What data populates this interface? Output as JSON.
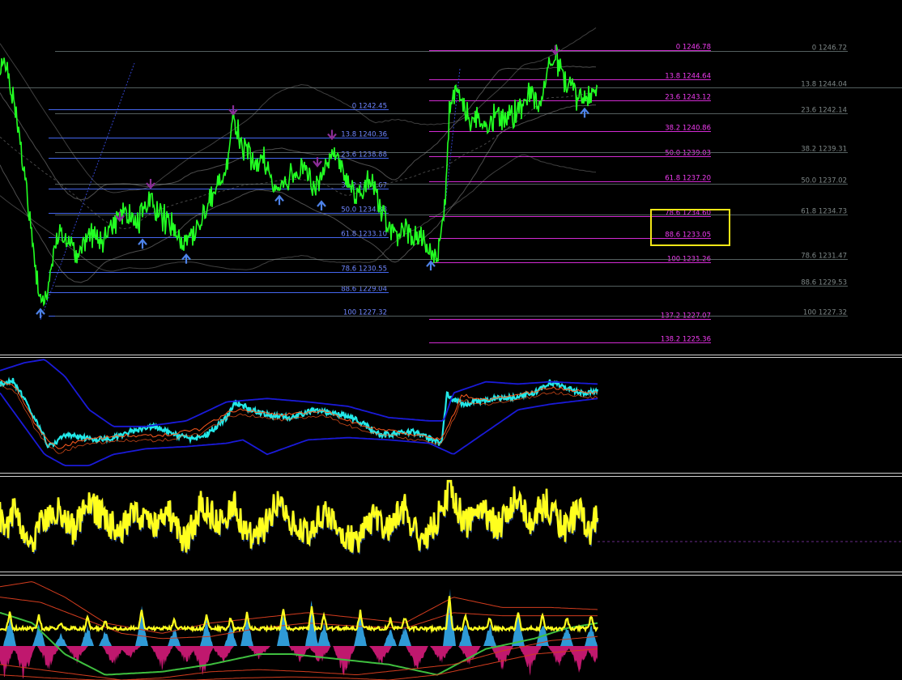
{
  "colors": {
    "background": "#000000",
    "price": "#22ff22",
    "fib_left": "#4466ee",
    "fib_left_text": "#6f86ff",
    "fib_mid": "#d22ad2",
    "fib_mid_text": "#f03cf0",
    "fib_right": "#5e6a6a",
    "fib_right_text": "#7e8787",
    "envelope": "#8c8c8c",
    "highlight_box": "#f3e617",
    "arrow_up": "#4d82e8",
    "arrow_down": "#8b2d96",
    "osc_fast": "#22e8e8",
    "osc_band": "#1a1ad8",
    "osc_slow": "#ff5a1e",
    "rsi": "#ffff1e",
    "rsi_shadow": "#3a6fd8",
    "hist_pos": "#2f9ad6",
    "hist_neg": "#c0186e",
    "ma_green": "#3fbf3f",
    "ma_red": "#d23c1e",
    "separator": "#cfcfcf"
  },
  "chart_data": [
    {
      "type": "line",
      "panel": "price",
      "x_range": [
        0,
        738
      ],
      "ylim": [
        1224.6,
        1250.0
      ],
      "series": [
        {
          "role": "close",
          "anchors_x": [
            0,
            10,
            20,
            30,
            38,
            48,
            55,
            62,
            70,
            82,
            95,
            110,
            125,
            140,
            155,
            170,
            185,
            200,
            212,
            225,
            235,
            250,
            265,
            278,
            288,
            300,
            312,
            325,
            335,
            345,
            360,
            375,
            390,
            400,
            410,
            420,
            432,
            445,
            458,
            470,
            480,
            490,
            505,
            520,
            530,
            538,
            545,
            550,
            555,
            562,
            572,
            580,
            590,
            600,
            612,
            625,
            640,
            655,
            668,
            678,
            686,
            693,
            700,
            710,
            722,
            730,
            738
          ],
          "anchors_y": [
            1246.0,
            1244.8,
            1242.0,
            1238.0,
            1234.0,
            1229.0,
            1228.6,
            1230.0,
            1233.5,
            1233.0,
            1232.0,
            1233.5,
            1232.5,
            1234.0,
            1235.0,
            1234.2,
            1236.0,
            1234.5,
            1234.0,
            1232.5,
            1233.0,
            1235.0,
            1236.5,
            1238.0,
            1241.5,
            1239.8,
            1238.5,
            1238.8,
            1237.5,
            1236.8,
            1237.5,
            1238.2,
            1236.5,
            1238.0,
            1239.5,
            1238.5,
            1237.0,
            1236.0,
            1237.2,
            1235.2,
            1233.5,
            1233.3,
            1233.5,
            1233.0,
            1232.0,
            1231.3,
            1233.0,
            1236.0,
            1242.0,
            1244.0,
            1243.0,
            1241.5,
            1242.0,
            1241.0,
            1242.0,
            1241.5,
            1242.5,
            1243.5,
            1242.5,
            1246.0,
            1246.3,
            1245.3,
            1244.0,
            1243.5,
            1243.0,
            1243.8,
            1244.0
          ]
        }
      ],
      "fibonacci_sets": [
        {
          "role": "left",
          "levels": [
            {
              "ratio": "0",
              "price": 1242.45,
              "label": "0 1242.45"
            },
            {
              "ratio": "13.8",
              "price": 1240.36,
              "label": "13.8 1240.36"
            },
            {
              "ratio": "23.6",
              "price": 1238.88,
              "label": "23.6 1238.88"
            },
            {
              "ratio": "38.2",
              "price": 1236.67,
              "label": "38.2 1236.67"
            },
            {
              "ratio": "50.0",
              "price": 1234.88,
              "label": "50.0 1234.88"
            },
            {
              "ratio": "61.8",
              "price": 1233.1,
              "label": "61.8 1233.10"
            },
            {
              "ratio": "78.6",
              "price": 1230.55,
              "label": "78.6 1230.55"
            },
            {
              "ratio": "88.6",
              "price": 1229.04,
              "label": "88.6 1229.04"
            },
            {
              "ratio": "100",
              "price": 1227.32,
              "label": "100 1227.32"
            }
          ]
        },
        {
          "role": "middle",
          "levels": [
            {
              "ratio": "0",
              "price": 1246.78,
              "label": "0 1246.78"
            },
            {
              "ratio": "13.8",
              "price": 1244.64,
              "label": "13.8 1244.64"
            },
            {
              "ratio": "23.6",
              "price": 1243.12,
              "label": "23.6 1243.12"
            },
            {
              "ratio": "38.2",
              "price": 1240.86,
              "label": "38.2 1240.86"
            },
            {
              "ratio": "50.0",
              "price": 1239.03,
              "label": "50.0 1239.03"
            },
            {
              "ratio": "61.8",
              "price": 1237.2,
              "label": "61.8 1237.20"
            },
            {
              "ratio": "78.6",
              "price": 1234.6,
              "label": "78.6 1234.60"
            },
            {
              "ratio": "88.6",
              "price": 1233.05,
              "label": "88.6 1233.05"
            },
            {
              "ratio": "100",
              "price": 1231.26,
              "label": "100 1231.26"
            },
            {
              "ratio": "137.2",
              "price": 1227.07,
              "label": "137.2 1227.07"
            },
            {
              "ratio": "138.2",
              "price": 1225.36,
              "label": "138.2 1225.36"
            }
          ]
        },
        {
          "role": "right",
          "levels": [
            {
              "ratio": "0",
              "price": 1246.72,
              "label": "0 1246.72"
            },
            {
              "ratio": "13.8",
              "price": 1244.04,
              "label": "13.8 1244.04"
            },
            {
              "ratio": "23.6",
              "price": 1242.14,
              "label": "23.6 1242.14"
            },
            {
              "ratio": "38.2",
              "price": 1239.31,
              "label": "38.2 1239.31"
            },
            {
              "ratio": "50.0",
              "price": 1237.02,
              "label": "50.0 1237.02"
            },
            {
              "ratio": "61.8",
              "price": 1234.73,
              "label": "61.8 1234.73"
            },
            {
              "ratio": "78.6",
              "price": 1231.47,
              "label": "78.6 1231.47"
            },
            {
              "ratio": "88.6",
              "price": 1229.53,
              "label": "88.6 1229.53"
            },
            {
              "ratio": "100",
              "price": 1227.32,
              "label": "100 1227.32"
            }
          ]
        }
      ],
      "highlighted_levels": [
        "78.6 1234.60",
        "88.6 1233.05"
      ],
      "arrows": [
        {
          "x": 50,
          "price": 1227.5,
          "dir": "up"
        },
        {
          "x": 148,
          "price": 1234.6,
          "dir": "down"
        },
        {
          "x": 176,
          "price": 1232.6,
          "dir": "up"
        },
        {
          "x": 186,
          "price": 1237.0,
          "dir": "down"
        },
        {
          "x": 230,
          "price": 1231.5,
          "dir": "up"
        },
        {
          "x": 288,
          "price": 1242.4,
          "dir": "down"
        },
        {
          "x": 345,
          "price": 1235.8,
          "dir": "up"
        },
        {
          "x": 392,
          "price": 1238.6,
          "dir": "down"
        },
        {
          "x": 397,
          "price": 1235.4,
          "dir": "up"
        },
        {
          "x": 410,
          "price": 1240.6,
          "dir": "down"
        },
        {
          "x": 532,
          "price": 1231.0,
          "dir": "up"
        },
        {
          "x": 686,
          "price": 1246.8,
          "dir": "down"
        },
        {
          "x": 722,
          "price": 1242.2,
          "dir": "up"
        }
      ]
    },
    {
      "type": "line",
      "panel": "oscillator",
      "x_range": [
        0,
        738
      ],
      "series": [
        {
          "role": "fast",
          "anchors_x": [
            0,
            15,
            30,
            45,
            60,
            80,
            100,
            130,
            160,
            190,
            220,
            240,
            260,
            280,
            290,
            310,
            330,
            360,
            390,
            410,
            430,
            450,
            470,
            490,
            510,
            530,
            545,
            552,
            560,
            575,
            600,
            630,
            660,
            680,
            700,
            720,
            738
          ],
          "anchors_y": [
            0.22,
            0.18,
            0.35,
            0.55,
            0.78,
            0.68,
            0.7,
            0.72,
            0.65,
            0.6,
            0.68,
            0.72,
            0.65,
            0.52,
            0.38,
            0.45,
            0.5,
            0.52,
            0.45,
            0.48,
            0.5,
            0.58,
            0.68,
            0.66,
            0.65,
            0.7,
            0.76,
            0.3,
            0.36,
            0.4,
            0.36,
            0.34,
            0.3,
            0.2,
            0.26,
            0.3,
            0.29
          ]
        },
        {
          "role": "band_upper",
          "anchors_x": [
            0,
            30,
            55,
            80,
            110,
            140,
            180,
            230,
            280,
            330,
            380,
            430,
            480,
            530,
            548,
            560,
            600,
            640,
            680,
            738
          ],
          "anchors_y": [
            0.1,
            0.03,
            0.0,
            0.15,
            0.45,
            0.6,
            0.6,
            0.55,
            0.38,
            0.35,
            0.38,
            0.42,
            0.52,
            0.55,
            0.55,
            0.3,
            0.2,
            0.22,
            0.2,
            0.22
          ]
        },
        {
          "role": "band_lower",
          "anchors_x": [
            0,
            30,
            55,
            80,
            110,
            140,
            180,
            230,
            280,
            300,
            330,
            380,
            430,
            480,
            530,
            560,
            600,
            640,
            680,
            738
          ],
          "anchors_y": [
            0.3,
            0.6,
            0.85,
            0.95,
            0.95,
            0.85,
            0.8,
            0.78,
            0.75,
            0.72,
            0.85,
            0.72,
            0.7,
            0.72,
            0.75,
            0.85,
            0.65,
            0.45,
            0.4,
            0.35
          ]
        },
        {
          "role": "slow",
          "anchors_x": [
            0,
            20,
            45,
            70,
            100,
            150,
            200,
            250,
            280,
            300,
            350,
            400,
            450,
            500,
            545,
            555,
            570,
            600,
            640,
            680,
            738
          ],
          "anchors_y": [
            0.18,
            0.25,
            0.6,
            0.8,
            0.72,
            0.68,
            0.68,
            0.62,
            0.48,
            0.45,
            0.5,
            0.46,
            0.6,
            0.66,
            0.72,
            0.58,
            0.32,
            0.36,
            0.32,
            0.25,
            0.3
          ]
        }
      ]
    },
    {
      "type": "line",
      "panel": "rsi",
      "x_range": [
        0,
        738
      ],
      "reference_value": 0.5,
      "series": [
        {
          "role": "rsi",
          "anchors_x": [
            0,
            8,
            20,
            35,
            50,
            70,
            90,
            110,
            130,
            150,
            165,
            185,
            210,
            230,
            250,
            270,
            290,
            305,
            325,
            345,
            360,
            380,
            400,
            420,
            440,
            460,
            480,
            500,
            520,
            540,
            555,
            575,
            595,
            615,
            635,
            655,
            675,
            695,
            715,
            730,
            738
          ],
          "anchors_y": [
            0.4,
            0.55,
            0.3,
            0.75,
            0.5,
            0.35,
            0.55,
            0.25,
            0.45,
            0.6,
            0.3,
            0.55,
            0.4,
            0.7,
            0.25,
            0.5,
            0.3,
            0.65,
            0.55,
            0.2,
            0.45,
            0.6,
            0.35,
            0.55,
            0.7,
            0.4,
            0.55,
            0.3,
            0.75,
            0.45,
            0.1,
            0.5,
            0.3,
            0.55,
            0.2,
            0.45,
            0.25,
            0.55,
            0.35,
            0.65,
            0.3
          ]
        }
      ]
    },
    {
      "type": "area",
      "panel": "histogram",
      "x_range": [
        0,
        738
      ],
      "spikes_up": [
        [
          12,
          0.5
        ],
        [
          48,
          0.4
        ],
        [
          75,
          0.2
        ],
        [
          108,
          0.35
        ],
        [
          130,
          0.25
        ],
        [
          175,
          0.6
        ],
        [
          215,
          0.3
        ],
        [
          255,
          0.45
        ],
        [
          285,
          0.35
        ],
        [
          305,
          0.5
        ],
        [
          350,
          0.6
        ],
        [
          385,
          0.7
        ],
        [
          400,
          0.4
        ],
        [
          445,
          0.55
        ],
        [
          482,
          0.3
        ],
        [
          500,
          0.35
        ],
        [
          555,
          1.0
        ],
        [
          575,
          0.4
        ],
        [
          605,
          0.35
        ],
        [
          640,
          0.55
        ],
        [
          670,
          0.45
        ],
        [
          700,
          0.35
        ],
        [
          730,
          0.4
        ]
      ],
      "spikes_down": [
        [
          5,
          0.9
        ],
        [
          30,
          1.0
        ],
        [
          60,
          0.7
        ],
        [
          95,
          0.5
        ],
        [
          140,
          0.6
        ],
        [
          160,
          0.35
        ],
        [
          200,
          0.7
        ],
        [
          230,
          0.55
        ],
        [
          250,
          0.9
        ],
        [
          275,
          0.5
        ],
        [
          320,
          0.4
        ],
        [
          370,
          0.45
        ],
        [
          395,
          0.55
        ],
        [
          425,
          0.95
        ],
        [
          470,
          0.6
        ],
        [
          515,
          0.75
        ],
        [
          545,
          0.5
        ],
        [
          580,
          0.55
        ],
        [
          620,
          0.7
        ],
        [
          655,
          0.8
        ],
        [
          690,
          0.6
        ],
        [
          715,
          0.75
        ],
        [
          735,
          0.5
        ]
      ],
      "series": [
        {
          "role": "ma_green",
          "anchors_x": [
            0,
            40,
            80,
            130,
            200,
            260,
            320,
            360,
            420,
            480,
            540,
            600,
            660,
            700,
            738
          ],
          "anchors_y": [
            0.35,
            0.45,
            0.75,
            0.95,
            0.92,
            0.85,
            0.75,
            0.75,
            0.8,
            0.85,
            0.95,
            0.7,
            0.6,
            0.5,
            0.45
          ]
        },
        {
          "role": "ma_red_1",
          "anchors_x": [
            0,
            40,
            80,
            130,
            200,
            260,
            320,
            380,
            440,
            500,
            560,
            620,
            680,
            738
          ],
          "anchors_y": [
            0.1,
            0.05,
            0.2,
            0.45,
            0.55,
            0.45,
            0.4,
            0.35,
            0.4,
            0.45,
            0.2,
            0.3,
            0.3,
            0.32
          ]
        },
        {
          "role": "ma_red_2",
          "anchors_x": [
            0,
            50,
            100,
            150,
            200,
            260,
            320,
            380,
            440,
            500,
            560,
            620,
            680,
            738
          ],
          "anchors_y": [
            0.2,
            0.25,
            0.4,
            0.55,
            0.6,
            0.58,
            0.5,
            0.45,
            0.48,
            0.5,
            0.35,
            0.38,
            0.38,
            0.38
          ]
        },
        {
          "role": "ma_red_3",
          "anchors_x": [
            0,
            50,
            100,
            150,
            200,
            260,
            320,
            380,
            440,
            500,
            560,
            620,
            680,
            738
          ],
          "anchors_y": [
            0.85,
            0.9,
            0.95,
            1.0,
            0.98,
            0.92,
            0.9,
            0.92,
            0.95,
            0.9,
            0.85,
            0.72,
            0.62,
            0.58
          ]
        },
        {
          "role": "ma_red_4",
          "anchors_x": [
            0,
            60,
            120,
            180,
            240,
            300,
            360,
            420,
            480,
            540,
            600,
            660,
            738
          ],
          "anchors_y": [
            0.95,
            0.98,
            1.0,
            1.0,
            1.0,
            0.98,
            0.97,
            0.98,
            1.0,
            0.95,
            0.85,
            0.75,
            0.7
          ]
        }
      ]
    }
  ]
}
